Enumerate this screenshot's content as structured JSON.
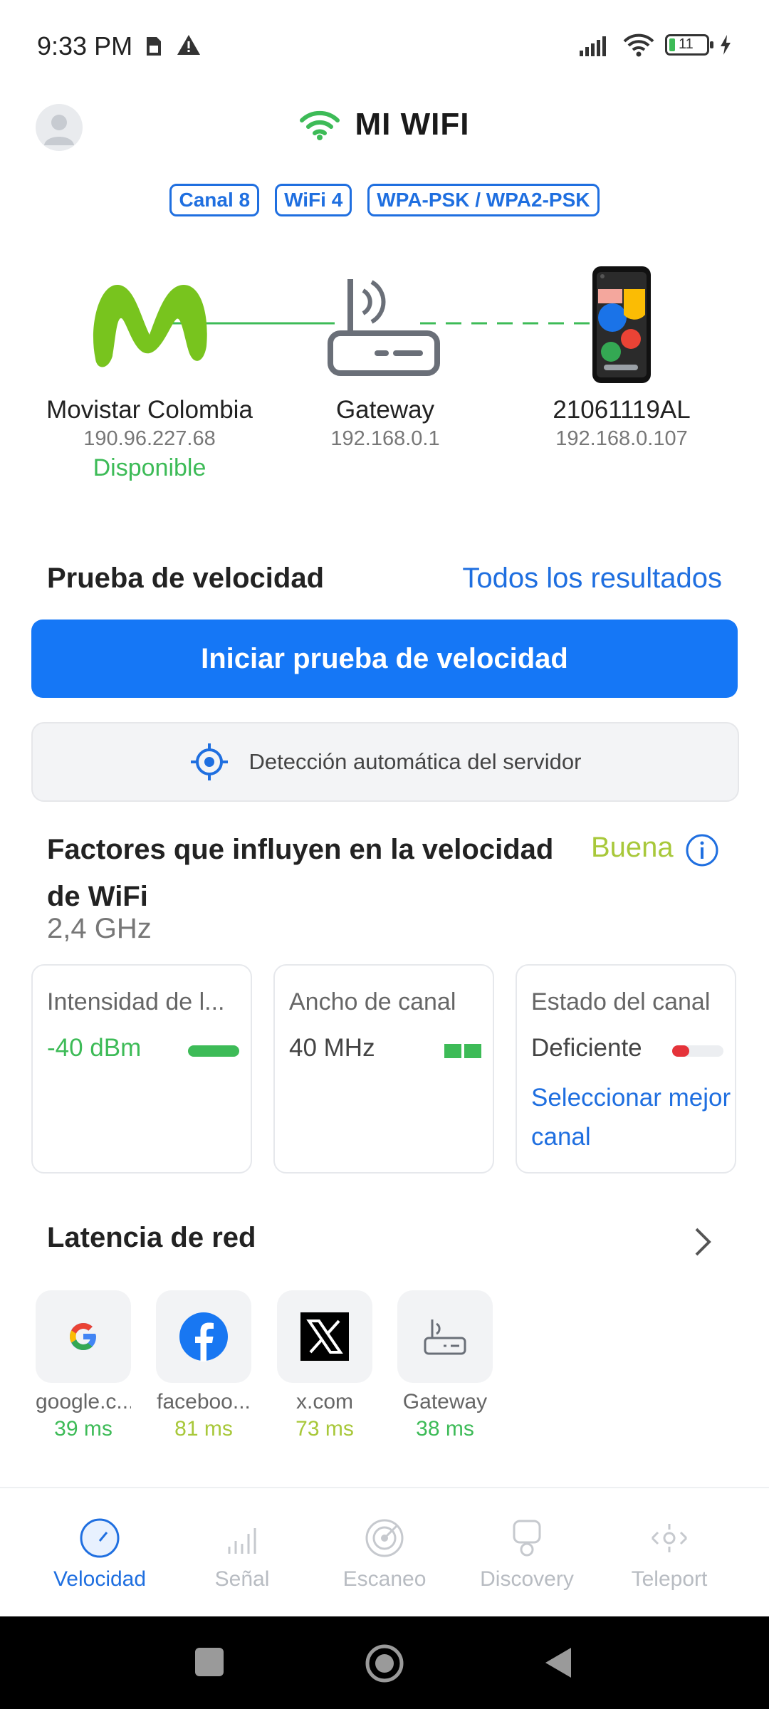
{
  "status_bar": {
    "time": "9:33 PM",
    "battery": "11"
  },
  "header": {
    "title": "MI WIFI"
  },
  "badges": [
    "Canal 8",
    "WiFi 4",
    "WPA-PSK / WPA2-PSK"
  ],
  "network": {
    "isp": {
      "name": "Movistar Colombia",
      "ip": "190.96.227.68",
      "status": "Disponible"
    },
    "gateway": {
      "name": "Gateway",
      "ip": "192.168.0.1"
    },
    "device": {
      "name": "21061119AL",
      "ip": "192.168.0.107"
    }
  },
  "speed_test": {
    "title": "Prueba de velocidad",
    "all_results": "Todos los resultados",
    "start_button": "Iniciar prueba de velocidad",
    "server": "Detección automática del servidor"
  },
  "factors": {
    "title": "Factores que influyen en la velocidad de WiFi",
    "status": "Buena",
    "band": "2,4 GHz",
    "cards": [
      {
        "heading": "Intensidad de l...",
        "value": "-40 dBm"
      },
      {
        "heading": "Ancho de canal",
        "value": "40 MHz"
      },
      {
        "heading": "Estado del canal",
        "value": "Deficiente",
        "link": "Seleccionar mejor canal"
      }
    ]
  },
  "latency": {
    "title": "Latencia de red",
    "items": [
      {
        "name": "google.c...",
        "ms": "39 ms"
      },
      {
        "name": "faceboo...",
        "ms": "81 ms"
      },
      {
        "name": "x.com",
        "ms": "73 ms"
      },
      {
        "name": "Gateway",
        "ms": "38 ms"
      }
    ]
  },
  "nav": [
    "Velocidad",
    "Señal",
    "Escaneo",
    "Discovery",
    "Teleport"
  ],
  "colors": {
    "accent": "#1577f6",
    "good": "#3dbb57",
    "fair": "#a8c83a",
    "bad": "#e5333a"
  }
}
